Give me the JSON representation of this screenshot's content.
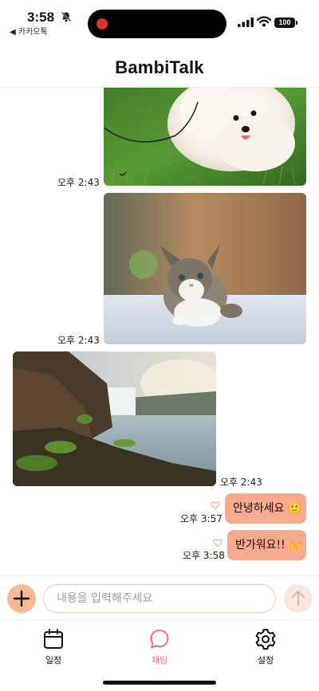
{
  "status": {
    "time": "3:58",
    "back_app": "◀ 카카오톡",
    "battery": "100",
    "icons": [
      "bell-off-icon",
      "signal-icon",
      "wifi-icon",
      "battery-icon"
    ]
  },
  "header": {
    "title": "BambiTalk"
  },
  "messages": [
    {
      "type": "image",
      "subject": "white pomeranian puppy on grass",
      "time": "오후 2:43",
      "side": "sent"
    },
    {
      "type": "image",
      "subject": "tabby kitten on white surface",
      "time": "오후 2:43",
      "side": "sent"
    },
    {
      "type": "image",
      "subject": "waterfall by rocky coast",
      "time": "오후 2:43",
      "side": "received"
    },
    {
      "type": "text",
      "text": "안녕하세요 🙂",
      "time": "오후 3:57",
      "side": "sent",
      "icon": "heart-outline-icon"
    },
    {
      "type": "text",
      "text": "반가워요!! 🙌",
      "time": "오후 3:58",
      "side": "sent",
      "icon": "heart-outline-icon"
    }
  ],
  "input": {
    "placeholder": "내용을 입력해주세요",
    "value": ""
  },
  "tabs": [
    {
      "label": "일정",
      "icon": "calendar-icon",
      "active": false
    },
    {
      "label": "채팅",
      "icon": "chat-bubble-icon",
      "active": true
    },
    {
      "label": "설정",
      "icon": "gear-icon",
      "active": false
    }
  ],
  "colors": {
    "accent": "#f6a98d",
    "active_tab": "#e8716b",
    "input_border": "#f1cda8"
  }
}
